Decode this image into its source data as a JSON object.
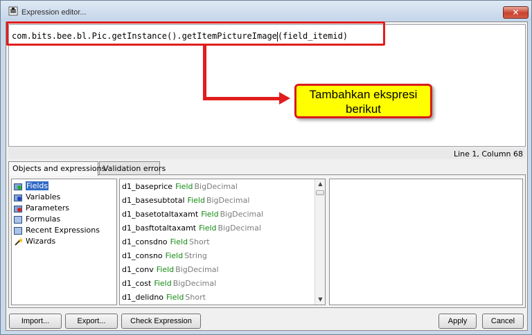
{
  "window": {
    "title": "Expression editor...",
    "close_label": "✕"
  },
  "editor": {
    "expression_before_caret": "com.bits.bee.bl.Pic.getInstance().getItemPictureImage",
    "expression_after_caret": "(field_itemid)",
    "cursor_status": "Line 1, Column 68"
  },
  "annotation": {
    "callout_line1": "Tambahkan ekspresi",
    "callout_line2": "berikut",
    "highlight_color": "#e11d1d",
    "callout_color": "#ffff00"
  },
  "tabs": [
    {
      "label": "Objects and expressions",
      "active": true
    },
    {
      "label": "Validation errors",
      "active": false
    }
  ],
  "categories": [
    {
      "label": "Fields",
      "icon": "fields-icon",
      "selected": true
    },
    {
      "label": "Variables",
      "icon": "variables-icon",
      "selected": false
    },
    {
      "label": "Parameters",
      "icon": "parameters-icon",
      "selected": false
    },
    {
      "label": "Formulas",
      "icon": "formulas-icon",
      "selected": false
    },
    {
      "label": "Recent Expressions",
      "icon": "recent-expressions-icon",
      "selected": false
    },
    {
      "label": "Wizards",
      "icon": "wizard-wand-icon",
      "selected": false
    }
  ],
  "fields": [
    {
      "name": "d1_baseprice",
      "kind": "Field",
      "type": "BigDecimal"
    },
    {
      "name": "d1_basesubtotal",
      "kind": "Field",
      "type": "BigDecimal"
    },
    {
      "name": "d1_basetotaltaxamt",
      "kind": "Field",
      "type": "BigDecimal"
    },
    {
      "name": "d1_basftotaltaxamt",
      "kind": "Field",
      "type": "BigDecimal"
    },
    {
      "name": "d1_consdno",
      "kind": "Field",
      "type": "Short"
    },
    {
      "name": "d1_consno",
      "kind": "Field",
      "type": "String"
    },
    {
      "name": "d1_conv",
      "kind": "Field",
      "type": "BigDecimal"
    },
    {
      "name": "d1_cost",
      "kind": "Field",
      "type": "BigDecimal"
    },
    {
      "name": "d1_delidno",
      "kind": "Field",
      "type": "Short"
    }
  ],
  "buttons": {
    "import": "Import...",
    "export": "Export...",
    "check": "Check Expression",
    "apply": "Apply",
    "cancel": "Cancel"
  },
  "scrollbar": {
    "up": "▲",
    "down": "▼"
  }
}
